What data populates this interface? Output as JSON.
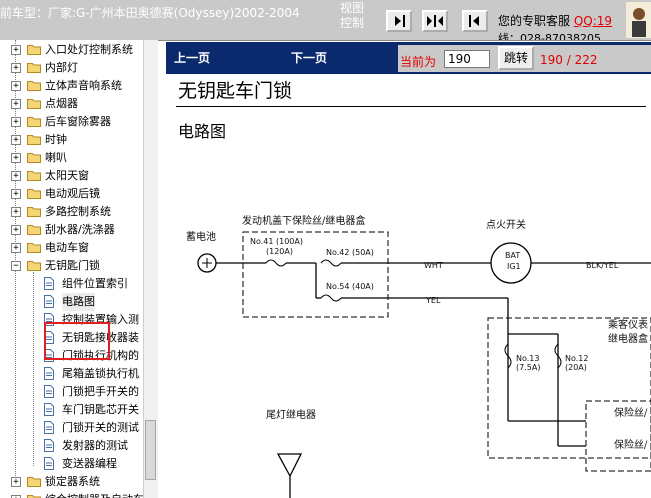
{
  "header": {
    "vehicle_title": "前车型：厂家:G-广州本田奥德赛(Odyssey)2002-2004",
    "view_control_line1": "视图",
    "view_control_line2": "控制",
    "service_text": "您的专职客服",
    "qq_link": "QQ:19",
    "phone_text": "线：028-87038205"
  },
  "tree": {
    "items": [
      {
        "label": "入口处灯控制系统",
        "type": "folder",
        "expander": "+"
      },
      {
        "label": "内部灯",
        "type": "folder",
        "expander": "+"
      },
      {
        "label": "立体声音响系统",
        "type": "folder",
        "expander": "+"
      },
      {
        "label": "点烟器",
        "type": "folder",
        "expander": "+"
      },
      {
        "label": "后车窗除雾器",
        "type": "folder",
        "expander": "+"
      },
      {
        "label": "时钟",
        "type": "folder",
        "expander": "+"
      },
      {
        "label": "喇叭",
        "type": "folder",
        "expander": "+"
      },
      {
        "label": "太阳天窗",
        "type": "folder",
        "expander": "+"
      },
      {
        "label": "电动观后镜",
        "type": "folder",
        "expander": "+"
      },
      {
        "label": "多路控制系统",
        "type": "folder",
        "expander": "+"
      },
      {
        "label": "刮水器/洗涤器",
        "type": "folder",
        "expander": "+"
      },
      {
        "label": "电动车窗",
        "type": "folder",
        "expander": "+"
      },
      {
        "label": "无钥匙门锁",
        "type": "folder",
        "expander": "−"
      },
      {
        "label": "组件位置索引",
        "type": "doc"
      },
      {
        "label": "电路图",
        "type": "doc",
        "selected": true
      },
      {
        "label": "控制装置输入测",
        "type": "doc"
      },
      {
        "label": "无钥匙接收器装",
        "type": "doc"
      },
      {
        "label": "门锁执行机构的",
        "type": "doc"
      },
      {
        "label": "尾箱盖锁执行机",
        "type": "doc"
      },
      {
        "label": "门锁把手开关的",
        "type": "doc"
      },
      {
        "label": "车门钥匙芯开关",
        "type": "doc"
      },
      {
        "label": "门锁开关的测试",
        "type": "doc"
      },
      {
        "label": "发射器的测试",
        "type": "doc"
      },
      {
        "label": "变送器编程",
        "type": "doc"
      },
      {
        "label": "锁定器系统",
        "type": "folder",
        "expander": "+"
      },
      {
        "label": "综合控制器及自动车窗",
        "type": "folder",
        "expander": "+"
      }
    ]
  },
  "pager": {
    "prev_label": "上一页",
    "next_label": "下一页",
    "current_label": "当前为",
    "current_value": "190",
    "jump_label": "跳转",
    "total_text": "190 / 222"
  },
  "document": {
    "title": "无钥匙车门锁",
    "subtitle": "电路图",
    "diagram": {
      "battery_label": "蓄电池",
      "fuse_box_label": "发动机盖下保险丝/继电器盒",
      "fuse_41_line1": "No.41 (100A)",
      "fuse_41_line2": "(120A)",
      "fuse_42": "No.42 (50A)",
      "fuse_54": "No.54 (40A)",
      "wire_wht": "WHT",
      "wire_yel": "YEL",
      "ignition_label": "点火开关",
      "bat_label": "BAT",
      "ig1_label": "IG1",
      "wire_blkyel": "BLK/YEL",
      "passenger_box_line1": "乘客仪表",
      "passenger_box_line2": "继电器盒",
      "fuse_13_line1": "No.13",
      "fuse_13_line2": "(7.5A)",
      "fuse_12_line1": "No.12",
      "fuse_12_line2": "(20A)",
      "fuse_label_1": "保险丝/",
      "fuse_label_2": "保险丝/",
      "taillight_relay": "尾灯继电器"
    }
  },
  "colors": {
    "pager_bg": "#0b2a6e",
    "accent_red": "#e00000",
    "toolbar_bg": "#c9c9c9"
  }
}
